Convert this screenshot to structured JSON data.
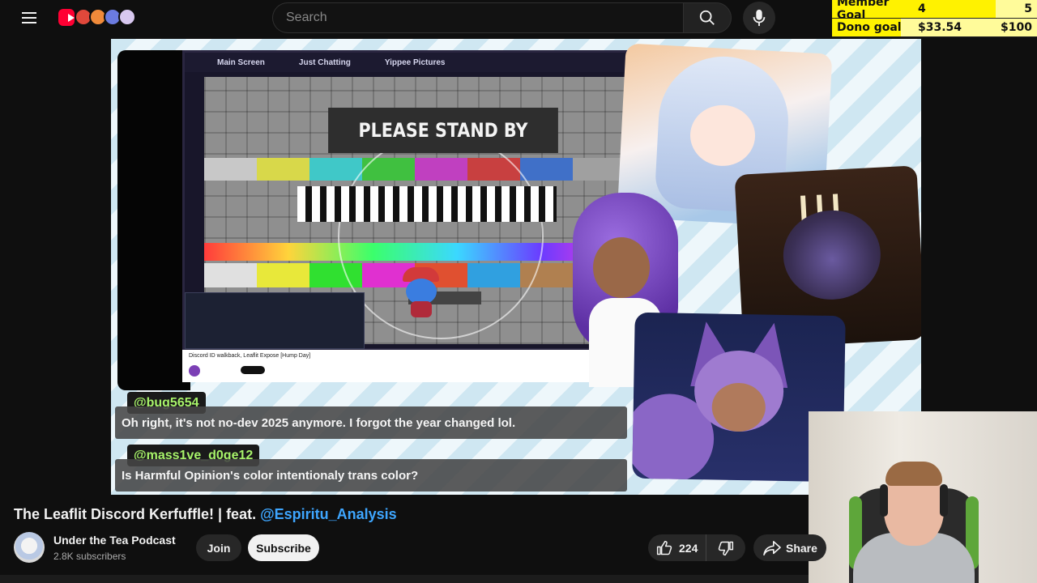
{
  "header": {
    "search_placeholder": "Search",
    "icons": [
      "menu-icon",
      "youtube-logo",
      "search-icon",
      "mic-icon"
    ]
  },
  "goals": {
    "member": {
      "label": "Member Goal",
      "current": "4",
      "target": "5",
      "progress": 0.8
    },
    "dono": {
      "label": "Dono goal",
      "current": "$33.54",
      "target": "$100",
      "progress": 0.3354
    }
  },
  "video": {
    "stream_tabs": [
      "Main Screen",
      "Just Chatting",
      "Yippee Pictures"
    ],
    "test_card_text": "PLEASE STAND BY",
    "embedded_title": "Discord ID walkback, Leaflit Expose [Hump Day]",
    "chat": [
      {
        "user": "@bug5654",
        "message": "Oh right, it's not no-dev 2025 anymore. I forgot the year changed lol."
      },
      {
        "user": "@mass1ve_d0ge12",
        "message": "Is Harmful Opinion's color intentionaly trans color?"
      }
    ]
  },
  "meta": {
    "title_main": "The Leaflit Discord Kerfuffle! | feat. ",
    "title_mention": "@Espiritu_Analysis",
    "channel_name": "Under the Tea Podcast",
    "subscribers": "2.8K subscribers",
    "join_label": "Join",
    "subscribe_label": "Subscribe",
    "likes": "224",
    "share_label": "Share"
  },
  "colors": {
    "accent": "#3ea6ff",
    "chat_user": "#a7f36a",
    "goal_fill": "#fff200",
    "brand_red": "#ff0033"
  }
}
